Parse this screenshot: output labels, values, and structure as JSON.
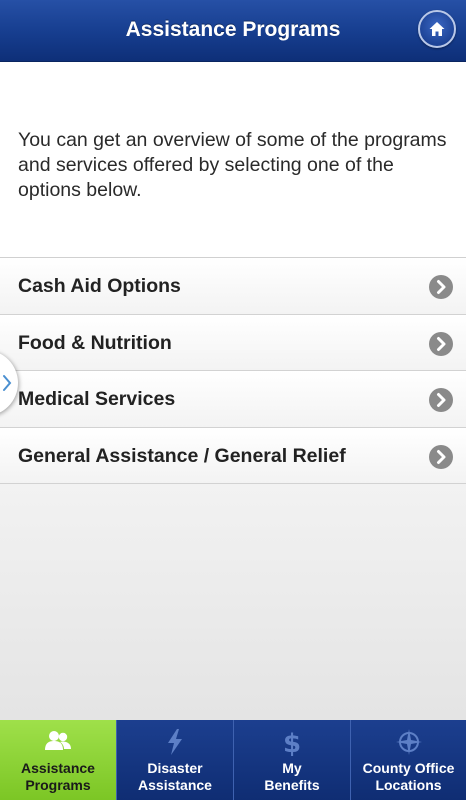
{
  "header": {
    "title": "Assistance Programs",
    "home_icon": "home-icon"
  },
  "intro": {
    "text": "You can get an overview of some of the programs and services offered by selecting one of the options below."
  },
  "menu": {
    "items": [
      {
        "label": "Cash Aid Options",
        "icon": "chevron-right-icon"
      },
      {
        "label": "Food & Nutrition",
        "icon": "chevron-right-icon"
      },
      {
        "label": "Medical Services",
        "icon": "chevron-right-icon"
      },
      {
        "label": "General Assistance / General Relief",
        "icon": "chevron-right-icon"
      }
    ]
  },
  "side_tab": {
    "icon": "chevron-right-icon"
  },
  "tabbar": {
    "tabs": [
      {
        "label": "Assistance\nPrograms",
        "icon": "people-icon",
        "active": true
      },
      {
        "label": "Disaster\nAssistance",
        "icon": "lightning-icon",
        "active": false
      },
      {
        "label": "My\nBenefits",
        "icon": "dollar-icon",
        "active": false
      },
      {
        "label": "County Office\nLocations",
        "icon": "compass-icon",
        "active": false
      }
    ]
  },
  "colors": {
    "header_blue": "#163d8e",
    "active_tab_green": "#8ad434",
    "tab_blue": "#0f2d73",
    "chevron_gray": "#8a8a8a"
  }
}
